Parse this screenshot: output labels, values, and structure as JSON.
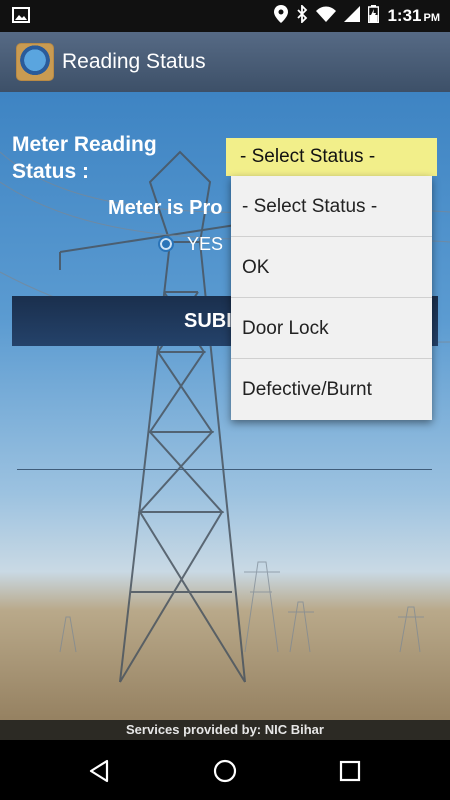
{
  "status_bar": {
    "time": "1:31",
    "ampm": "PM",
    "icons": [
      "image-icon",
      "location-icon",
      "bluetooth-icon",
      "wifi-icon",
      "signal-icon",
      "battery-charging-icon"
    ]
  },
  "app_bar": {
    "title": "Reading Status",
    "logo": "app-logo"
  },
  "form": {
    "meter_reading_label": "Meter Reading Status :",
    "status_select_value": "- Select Status -",
    "meter_proper_label": "Meter is Pro",
    "radio_yes_label": "YES",
    "submit_label": "SUBI"
  },
  "dropdown": {
    "options": [
      "- Select Status -",
      "OK",
      "Door Lock",
      "Defective/Burnt"
    ]
  },
  "footer": {
    "text": "Services provided by: NIC Bihar"
  },
  "nav": {
    "icons": [
      "back-icon",
      "home-icon",
      "recents-icon"
    ]
  }
}
